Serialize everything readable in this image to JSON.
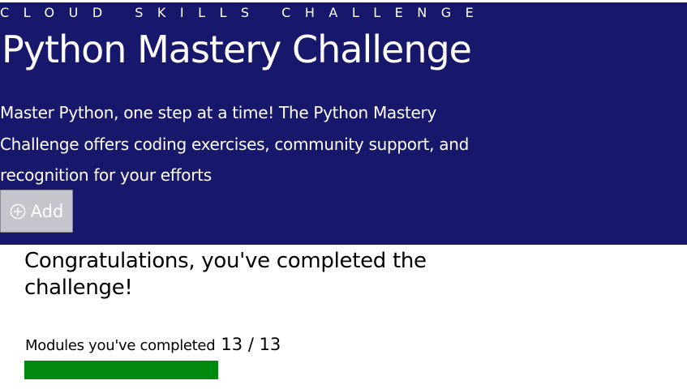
{
  "hero": {
    "eyebrow": "CLOUD SKILLS CHALLENGE",
    "title": "Python Mastery Challenge",
    "description": "Master Python, one step at a time! The Python Mastery Challenge offers coding exercises, community support, and recognition for your efforts",
    "add_button_label": "Add",
    "add_button_icon": "circle-plus-icon",
    "background_color": "#17176b"
  },
  "progress": {
    "heading": "Congratulations, you've completed the challenge!",
    "modules_label": "Modules you've completed",
    "modules_count": "13 / 13",
    "completed": 13,
    "total": 13,
    "fraction": 1.0,
    "bar_color": "#008a0e"
  }
}
